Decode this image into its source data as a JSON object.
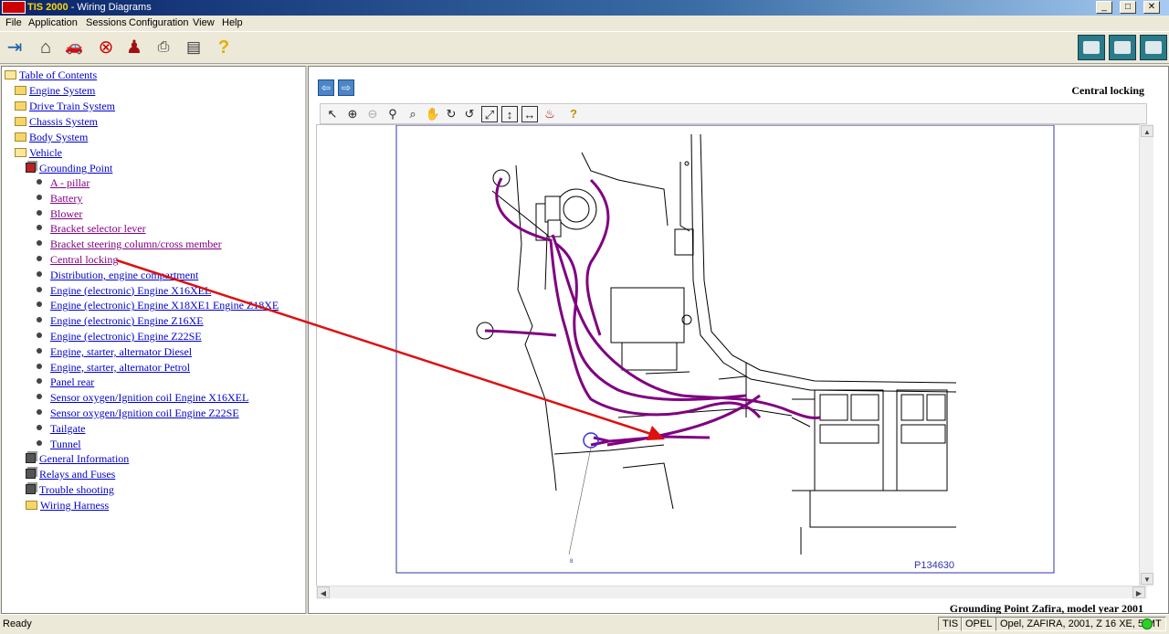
{
  "titlebar": {
    "app_name": "TIS 2000",
    "separator": " - ",
    "window_title": "Wiring Diagrams"
  },
  "menu": [
    "File",
    "Application",
    "Sessions",
    "Configuration",
    "View",
    "Help"
  ],
  "toolbar": {
    "left_icons": [
      "exit-icon",
      "home-icon",
      "vehicle-icon",
      "cancel-icon",
      "user-icon",
      "print-icon",
      "notes-icon",
      "help-icon"
    ],
    "right_icons": [
      "sps-icon",
      "tech2-icon",
      "diagnosis-icon"
    ]
  },
  "tree": {
    "root": "Table of Contents",
    "sections": {
      "engine": "Engine System",
      "drive_train": "Drive Train System",
      "chassis": "Chassis System",
      "body": "Body System",
      "vehicle": "Vehicle",
      "grounding": "Grounding Point",
      "general": "General Information",
      "relays": "Relays and Fuses",
      "trouble": "Trouble shooting",
      "harness": "Wiring Harness"
    },
    "grounding_items": [
      "A - pillar",
      "Battery",
      "Blower",
      "Bracket selector lever",
      "Bracket steering column/cross member",
      "Central locking",
      "Distribution, engine compartment",
      "Engine (electronic) Engine X16XEL",
      "Engine (electronic) Engine X18XE1 Engine Z18XE",
      "Engine (electronic) Engine Z16XE",
      "Engine (electronic) Engine Z22SE",
      "Engine, starter, alternator Diesel",
      "Engine, starter, alternator Petrol",
      "Panel rear",
      "Sensor oxygen/Ignition coil Engine X16XEL",
      "Sensor oxygen/Ignition coil Engine Z22SE",
      "Tailgate",
      "Tunnel"
    ]
  },
  "viewer": {
    "heading": "Central locking",
    "figure_id": "P134630",
    "ground_label": "8",
    "caption": "Grounding Point Zafira, model year 2001",
    "tools": [
      "select-icon",
      "zoom-in-icon",
      "zoom-out-icon",
      "zoom-fit-icon",
      "zoom-window-icon",
      "pan-icon",
      "rotate-right-icon",
      "rotate-left-icon",
      "fit-all-icon",
      "fit-height-icon",
      "fit-width-icon",
      "highlight-icon",
      "help-icon"
    ]
  },
  "status": {
    "text": "Ready",
    "panels": [
      "TIS",
      "OPEL",
      "Opel, ZAFIRA, 2001, Z 16 XE, 5-MT"
    ]
  },
  "colors": {
    "harness": "#800080",
    "annotation_arrow": "#dd1111",
    "frame": "#3333aa"
  }
}
